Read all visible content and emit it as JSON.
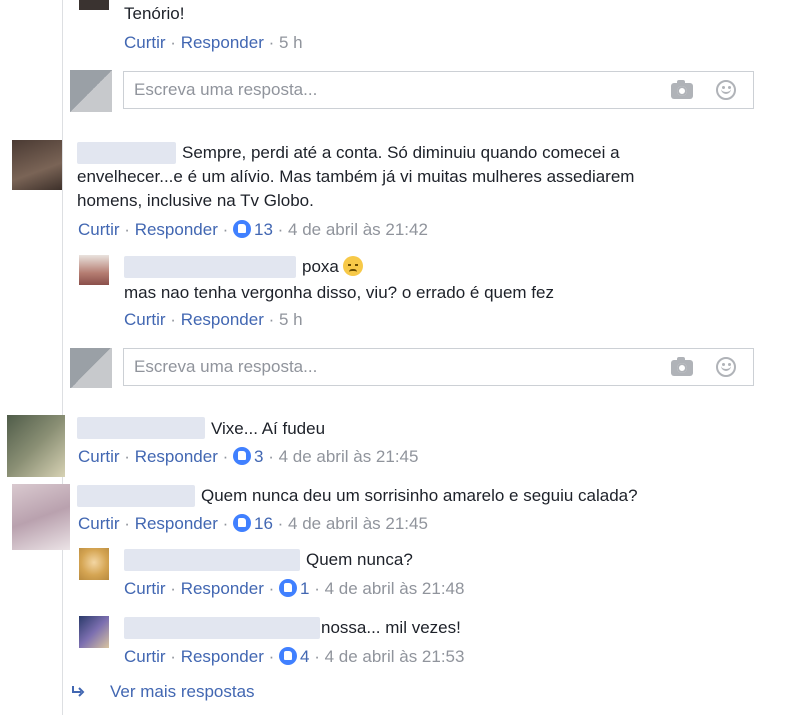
{
  "comments": {
    "c0": {
      "text_tail": "Tenório!",
      "actions": {
        "like": "Curtir",
        "reply": "Responder",
        "time": "5 h"
      }
    },
    "reply_box_placeholder": "Escreva uma resposta...",
    "c1": {
      "lines": [
        "Sempre, perdi até a conta. Só diminuiu quando comecei a",
        "envelhecer...e é um alívio. Mas também já vi muitas mulheres assediarem",
        "homens, inclusive na Tv Globo."
      ],
      "actions": {
        "like": "Curtir",
        "reply": "Responder",
        "likes": "13",
        "time": "4 de abril às 21:42"
      },
      "reply": {
        "text1": "poxa",
        "text2": "mas nao tenha vergonha disso, viu? o errado é quem fez",
        "actions": {
          "like": "Curtir",
          "reply": "Responder",
          "time": "5 h"
        }
      }
    },
    "c2": {
      "text": "Vixe... Aí fudeu",
      "actions": {
        "like": "Curtir",
        "reply": "Responder",
        "likes": "3",
        "time": "4 de abril às 21:45"
      }
    },
    "c3": {
      "text": "Quem nunca deu um sorrisinho amarelo e seguiu calada?",
      "actions": {
        "like": "Curtir",
        "reply": "Responder",
        "likes": "16",
        "time": "4 de abril às 21:45"
      },
      "reply1": {
        "text": "Quem nunca?",
        "actions": {
          "like": "Curtir",
          "reply": "Responder",
          "likes": "1",
          "time": "4 de abril às 21:48"
        }
      },
      "reply2": {
        "text": "nossa... mil vezes!",
        "actions": {
          "like": "Curtir",
          "reply": "Responder",
          "likes": "4",
          "time": "4 de abril às 21:53"
        }
      }
    },
    "more_replies": "Ver mais respostas"
  },
  "icons": [
    "camera-icon",
    "emoji-icon",
    "like-icon",
    "sad-emoji-icon",
    "reply-arrow-icon"
  ],
  "colors": {
    "link": "#4267b2",
    "meta": "#90949c",
    "like_blue": "#4080ff",
    "border": "#ccd0d5"
  }
}
